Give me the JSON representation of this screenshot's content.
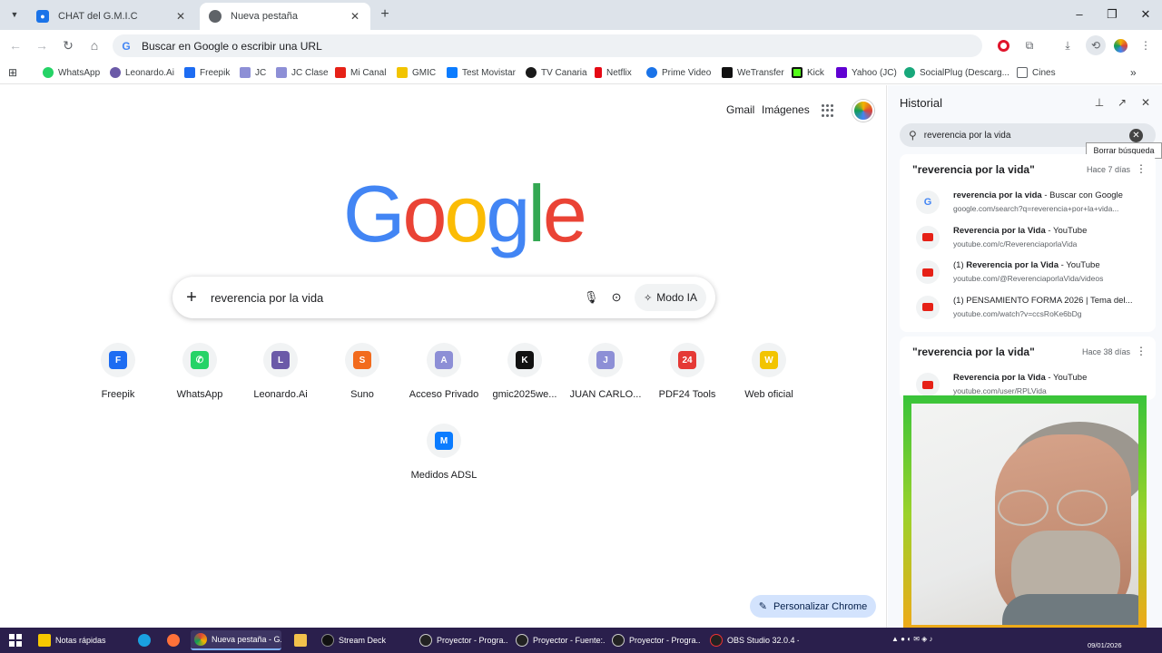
{
  "browser": {
    "tabs": [
      {
        "title": "CHAT del G.M.I.C",
        "active": false
      },
      {
        "title": "Nueva pestaña",
        "active": true
      }
    ],
    "omnibox_placeholder": "Buscar en Google o escribir una URL",
    "bookmarks": [
      "WhatsApp",
      "Leonardo.Ai",
      "Freepik",
      "JC",
      "JC Clase",
      "Mi Canal",
      "GMIC",
      "Test Movistar",
      "TV Canaria",
      "Netflix",
      "Prime Video",
      "WeTransfer",
      "Kick",
      "Yahoo (JC)",
      "SocialPlug (Descarg...",
      "Cines"
    ]
  },
  "ntp": {
    "gmail": "Gmail",
    "images": "Imágenes",
    "logo": [
      "G",
      "o",
      "o",
      "g",
      "l",
      "e"
    ],
    "logo_colors": [
      "#4285f4",
      "#ea4335",
      "#fbbc05",
      "#4285f4",
      "#34a853",
      "#ea4335"
    ],
    "search_query": "reverencia por la vida",
    "modo_ia": "Modo IA",
    "shortcuts": [
      {
        "label": "Freepik",
        "icon": "freepik-icon",
        "color": "#1d6cf2",
        "glyph": "F"
      },
      {
        "label": "WhatsApp",
        "icon": "whatsapp-icon",
        "color": "#25d366",
        "glyph": "✆"
      },
      {
        "label": "Leonardo.Ai",
        "icon": "leonardo-icon",
        "color": "#6b5aa8",
        "glyph": "L"
      },
      {
        "label": "Suno",
        "icon": "suno-icon",
        "color": "#f26b1d",
        "glyph": "S"
      },
      {
        "label": "Acceso Privado",
        "icon": "acceso-privado-icon",
        "color": "#8d8fd6",
        "glyph": "A"
      },
      {
        "label": "gmic2025we...",
        "icon": "kick-icon",
        "color": "#111111",
        "glyph": "K"
      },
      {
        "label": "JUAN CARLO...",
        "icon": "juan-carlos-icon",
        "color": "#8d8fd6",
        "glyph": "J"
      },
      {
        "label": "PDF24 Tools",
        "icon": "pdf24-icon",
        "color": "#e53935",
        "glyph": "24"
      },
      {
        "label": "Web oficial",
        "icon": "web-oficial-icon",
        "color": "#f2c400",
        "glyph": "W"
      },
      {
        "label": "Medidos ADSL",
        "icon": "movistar-icon",
        "color": "#0b7cff",
        "glyph": "M"
      }
    ],
    "customize": "Personalizar Chrome"
  },
  "history": {
    "title": "Historial",
    "search": "reverencia por la vida",
    "clear_tooltip": "Borrar búsqueda",
    "groups": [
      {
        "query": "\"reverencia por la vida\"",
        "age": "Hace 7 días",
        "items": [
          {
            "title_bold": "reverencia por la vida",
            "title_rest": " - Buscar con Google",
            "url": "google.com/search?q=reverencia+por+la+vida...",
            "type": "google"
          },
          {
            "title_bold": "Reverencia por la Vida",
            "title_rest": " - YouTube",
            "url": "youtube.com/c/ReverenciaporlaVida",
            "type": "youtube"
          },
          {
            "title_pre": "(1) ",
            "title_bold": "Reverencia por la Vida",
            "title_rest": " - YouTube",
            "url": "youtube.com/@ReverenciaporlaVida/videos",
            "type": "youtube"
          },
          {
            "title_pre": "(1) PENSAMIENTO FORMA 2026 | Tema del...",
            "title_bold": "",
            "title_rest": "",
            "url": "youtube.com/watch?v=ccsRoKe6bDg",
            "type": "youtube"
          }
        ]
      },
      {
        "query": "\"reverencia por la vida\"",
        "age": "Hace 38 días",
        "items": [
          {
            "title_bold": "Reverencia por la Vida",
            "title_rest": " - YouTube",
            "url": "youtube.com/user/RPLVida",
            "type": "youtube"
          }
        ]
      }
    ]
  },
  "taskbar": {
    "apps": [
      "Notas rápidas",
      "Nueva pestaña - G...",
      "Stream Deck",
      "Proyector - Progra...",
      "Proyector - Fuente:...",
      "Proyector - Progra...",
      "OBS Studio 32.0.4 - ..."
    ],
    "date": "09/01/2026"
  }
}
